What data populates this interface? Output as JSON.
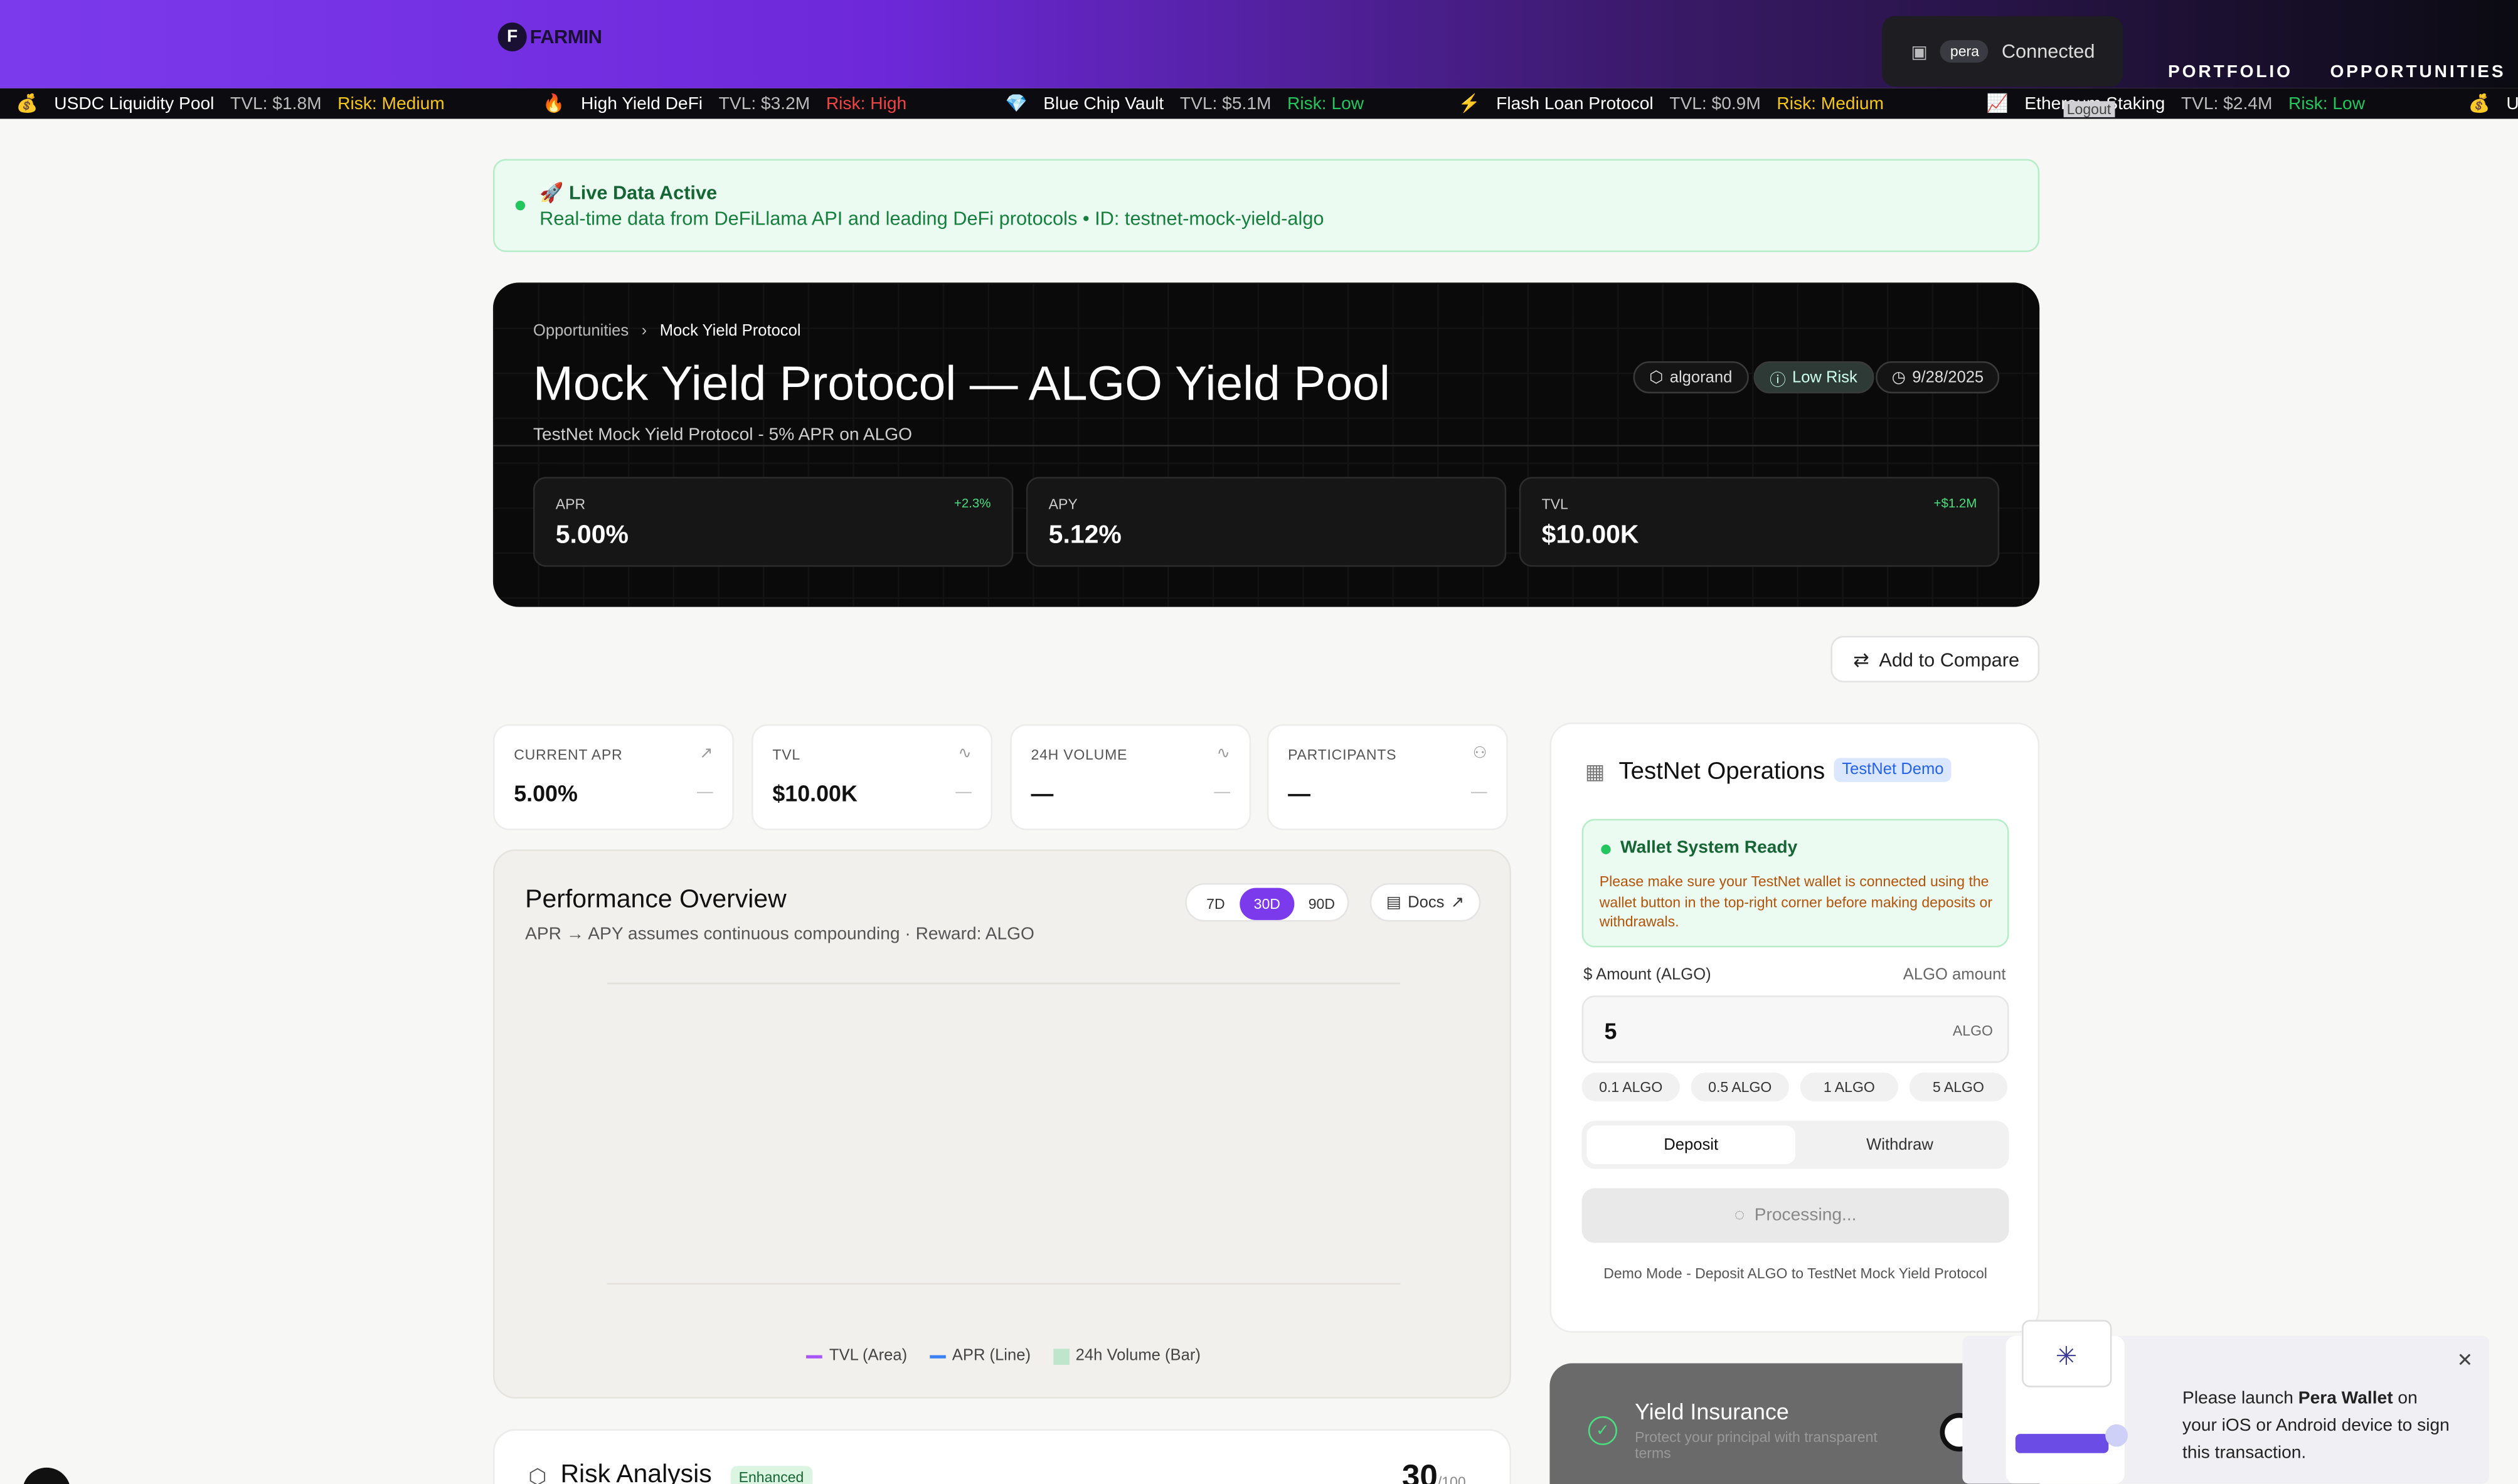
{
  "header": {
    "logo_text": "FARMIN",
    "logo_letter": "F",
    "wallet": {
      "provider": "pera",
      "status": "Connected"
    },
    "nav": [
      "PORTFOLIO",
      "OPPORTUNITIES"
    ],
    "logout": "Logout"
  },
  "ticker": [
    {
      "emoji": "💰",
      "name": "USDC Liquidity Pool",
      "tvl": "TVL: $1.8M",
      "risk": "Risk: Medium"
    },
    {
      "emoji": "🔥",
      "name": "High Yield DeFi",
      "tvl": "TVL: $3.2M",
      "risk": "Risk: High"
    },
    {
      "emoji": "💎",
      "name": "Blue Chip Vault",
      "tvl": "TVL: $5.1M",
      "risk": "Risk: Low"
    },
    {
      "emoji": "⚡",
      "name": "Flash Loan Protocol",
      "tvl": "TVL: $0.9M",
      "risk": "Risk: Medium"
    },
    {
      "emoji": "📈",
      "name": "Ethereum Staking",
      "tvl": "TVL: $2.4M",
      "risk": "Risk: Low"
    },
    {
      "emoji": "💰",
      "name": "U",
      "tvl": "",
      "risk": ""
    }
  ],
  "live": {
    "title": "🚀 Live Data Active",
    "subtitle": "Real-time data from DeFiLlama API and leading DeFi protocols • ID: testnet-mock-yield-algo"
  },
  "hero": {
    "breadcrumb": [
      "Opportunities",
      "Mock Yield Protocol"
    ],
    "title": "Mock Yield Protocol — ALGO Yield Pool",
    "subtitle": "TestNet Mock Yield Protocol - 5% APR on ALGO",
    "pills": [
      "algorand",
      "Low Risk",
      "9/28/2025"
    ],
    "metrics": [
      {
        "label": "APR",
        "value": "5.00%",
        "change": "+2.3%"
      },
      {
        "label": "APY",
        "value": "5.12%",
        "change": ""
      },
      {
        "label": "TVL",
        "value": "$10.00K",
        "change": "+$1.2M"
      }
    ]
  },
  "compare_label": "Add to Compare",
  "stats": [
    {
      "label": "CURRENT APR",
      "value": "5.00%",
      "delta": "—"
    },
    {
      "label": "TVL",
      "value": "$10.00K",
      "delta": "—"
    },
    {
      "label": "24H VOLUME",
      "value": "—",
      "delta": "—"
    },
    {
      "label": "PARTICIPANTS",
      "value": "—",
      "delta": "—"
    }
  ],
  "performance": {
    "title": "Performance Overview",
    "subtitle": "APR → APY assumes continuous compounding · Reward: ALGO",
    "ranges": [
      "7D",
      "30D",
      "90D"
    ],
    "active_range": "30D",
    "docs": "Docs",
    "legend": [
      "TVL (Area)",
      "APR (Line)",
      "24h Volume (Bar)"
    ],
    "legend_colors": [
      "#a855f7",
      "#3b82f6",
      "#bfe6cc"
    ]
  },
  "risk": {
    "title": "Risk Analysis",
    "badge": "Enhanced",
    "score": "30",
    "max": "/100"
  },
  "ops": {
    "title": "TestNet Operations",
    "badge": "TestNet Demo",
    "status_title": "Wallet System Ready",
    "status_text": "Please make sure your TestNet wallet is connected using the wallet button in the top-right corner before making deposits or withdrawals.",
    "amount_label": "Amount (ALGO)",
    "amount_hint": "ALGO amount",
    "amount_value": "5",
    "amount_unit": "ALGO",
    "chips": [
      "0.1 ALGO",
      "0.5 ALGO",
      "1 ALGO",
      "5 ALGO"
    ],
    "tabs": [
      "Deposit",
      "Withdraw"
    ],
    "processing": "Processing...",
    "demo_note": "Demo Mode - Deposit ALGO to TestNet Mock Yield Protocol"
  },
  "insurance": {
    "title": "Yield Insurance",
    "subtitle": "Protect your principal with transparent terms"
  },
  "popup": {
    "pre": "Please launch ",
    "brand": "Pera Wallet",
    "post": " on your iOS or Android device to sign this transaction."
  }
}
